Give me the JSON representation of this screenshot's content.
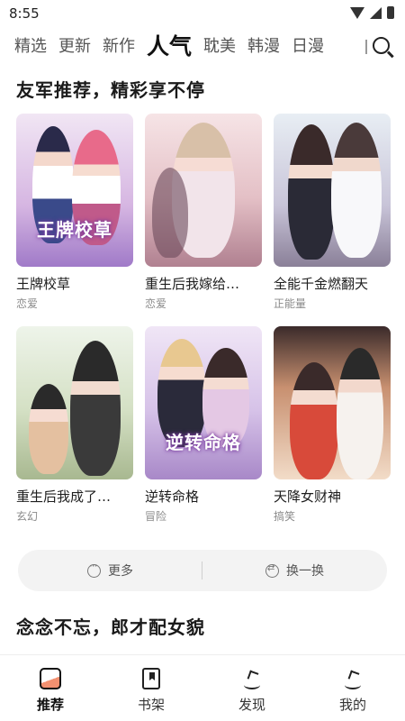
{
  "status_bar": {
    "time": "8:55"
  },
  "tabs": [
    {
      "label": "精选",
      "active": false
    },
    {
      "label": "更新",
      "active": false
    },
    {
      "label": "新作",
      "active": false
    },
    {
      "label": "人气",
      "active": true
    },
    {
      "label": "耽美",
      "active": false
    },
    {
      "label": "韩漫",
      "active": false
    },
    {
      "label": "日漫",
      "active": false
    }
  ],
  "section1": {
    "title": "友军推荐，精彩享不停"
  },
  "cards": [
    {
      "title": "王牌校草",
      "tag": "恋爱",
      "cover_text": "王牌校草",
      "colors": [
        "#f3e9f5",
        "#c9a2d8",
        "#7a5ab0"
      ]
    },
    {
      "title": "重生后我嫁给…",
      "tag": "恋爱",
      "cover_text": "",
      "colors": [
        "#f7e3e3",
        "#d8a0a8",
        "#8a4a5a"
      ]
    },
    {
      "title": "全能千金燃翻天",
      "tag": "正能量",
      "cover_text": "",
      "colors": [
        "#e8eef6",
        "#b8a8c8",
        "#4a3a5a"
      ]
    },
    {
      "title": "重生后我成了…",
      "tag": "玄幻",
      "cover_text": "",
      "colors": [
        "#eaf2e4",
        "#c8d6b0",
        "#3a4a3a"
      ]
    },
    {
      "title": "逆转命格",
      "tag": "冒险",
      "cover_text": "逆转命格",
      "colors": [
        "#efe6f6",
        "#c8b0e0",
        "#5a3a7a"
      ]
    },
    {
      "title": "天降女财神",
      "tag": "搞笑",
      "cover_text": "",
      "colors": [
        "#f2ece6",
        "#e0b890",
        "#7a4a3a"
      ]
    }
  ],
  "actions": {
    "more_label": "更多",
    "swap_label": "换一换"
  },
  "section2": {
    "title": "念念不忘，郎才配女貌"
  },
  "bottom_nav": [
    {
      "label": "推荐",
      "icon": "home-icon",
      "active": true
    },
    {
      "label": "书架",
      "icon": "bookshelf-icon",
      "active": false
    },
    {
      "label": "发现",
      "icon": "discover-icon",
      "active": false
    },
    {
      "label": "我的",
      "icon": "profile-icon",
      "active": false
    }
  ],
  "colors": {
    "accent": "#f29070",
    "highlight": "#f8d6c4",
    "pill_bg": "#f3f3f3"
  }
}
